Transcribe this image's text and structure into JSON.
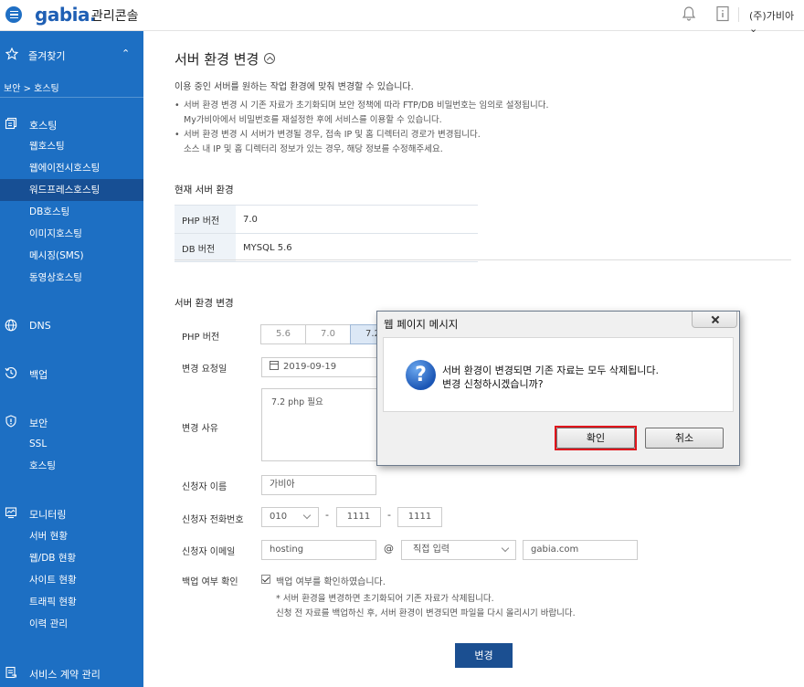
{
  "header": {
    "logo": "gabia.",
    "console": "관리콘솔",
    "account": "(주)가비아"
  },
  "sidebar": {
    "favorites": "즐겨찾기",
    "breadcrumb": "보안 > 호스팅",
    "groups": [
      {
        "label": "호스팅",
        "items": [
          "웹호스팅",
          "웹에이전시호스팅",
          "워드프레스호스팅",
          "DB호스팅",
          "이미지호스팅",
          "메시징(SMS)",
          "동영상호스팅"
        ]
      },
      {
        "label": "DNS",
        "items": []
      },
      {
        "label": "백업",
        "items": []
      },
      {
        "label": "보안",
        "items": [
          "SSL",
          "호스팅"
        ]
      },
      {
        "label": "모니터링",
        "items": [
          "서버 현황",
          "웹/DB 현황",
          "사이트 현황",
          "트래픽 현황",
          "이력 관리"
        ]
      },
      {
        "label": "서비스 계약 관리",
        "items": []
      }
    ],
    "active_item": "워드프레스호스팅"
  },
  "page": {
    "title": "서버 환경 변경",
    "intro": "이용 중인 서버를 원하는 작업 환경에 맞춰 변경할 수 있습니다.",
    "bullets": [
      [
        "서버 환경 변경 시 기존 자료가 초기화되며 보안 정책에 따라 FTP/DB 비밀번호는 임의로 설정됩니다.",
        "My가비아에서 비밀번호를 재설정한 후에 서비스를 이용할 수 있습니다."
      ],
      [
        "서버 환경 변경 시 서버가 변경될 경우, 접속 IP 및 홈 디렉터리 경로가 변경됩니다.",
        "소스 내 IP 및 홈 디렉터리 정보가 있는 경우, 해당 정보를 수정해주세요."
      ]
    ],
    "current_title": "현재 서버 환경",
    "current": [
      {
        "key": "PHP 버전",
        "value": "7.0"
      },
      {
        "key": "DB 버전",
        "value": "MYSQL 5.6"
      }
    ],
    "change_title": "서버 환경 변경"
  },
  "form": {
    "php_label": "PHP 버전",
    "php_options": [
      "5.6",
      "7.0",
      "7.2"
    ],
    "php_selected": "7.2",
    "date_label": "변경 요청일",
    "date_value": "2019-09-19",
    "reason_label": "변경 사유",
    "reason_value": "7.2 php 필요",
    "name_label": "신청자 이름",
    "name_value": "가비아",
    "phone_label": "신청자 전화번호",
    "phone_1": "010",
    "phone_2": "1111",
    "phone_3": "1111",
    "phone_sep": "-",
    "email_label": "신청자 이메일",
    "email_id": "hosting",
    "email_at": "@",
    "email_select": "직접 입력",
    "email_domain": "gabia.com",
    "backup_label": "백업 여부 확인",
    "backup_check": "백업 여부를 확인하였습니다.",
    "backup_note1": "* 서버 환경을 변경하면 초기화되어 기존 자료가 삭제됩니다.",
    "backup_note2": "신청 전 자료를 백업하신 후, 서버 환경이 변경되면 파일을 다시 올리시기 바랍니다.",
    "submit": "변경"
  },
  "dialog": {
    "title": "웹 페이지 메시지",
    "line1": "서버 환경이 변경되면 기존 자료는 모두 삭제됩니다.",
    "line2": "변경 신청하시겠습니까?",
    "ok": "확인",
    "cancel": "취소"
  }
}
